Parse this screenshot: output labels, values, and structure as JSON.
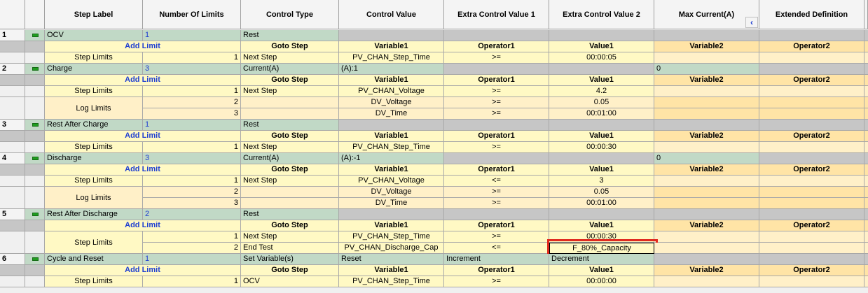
{
  "headers": [
    "",
    "",
    "Step Label",
    "Number Of Limits",
    "Control Type",
    "Control Value",
    "Extra Control Value 1",
    "Extra Control Value 2",
    "Max Current(A)",
    "Extended Definition"
  ],
  "add_limit_label": "Add Limit",
  "scroll_left_glyph": "‹",
  "limit_headers": [
    "Goto Step",
    "Variable1",
    "Operator1",
    "Value1",
    "Variable2",
    "Operator2"
  ],
  "steps": [
    {
      "num": "1",
      "label": "OCV",
      "limits": "1",
      "ctype": "Rest",
      "cvalue": "",
      "extra1": "",
      "extra2": "",
      "maxcur": "",
      "limit_groups": [
        {
          "group": "Step Limits",
          "rows": [
            {
              "n": "1",
              "goto": "Next Step",
              "var1": "PV_CHAN_Step_Time",
              "op1": ">=",
              "val1": "00:00:05"
            }
          ]
        }
      ]
    },
    {
      "num": "2",
      "label": "Charge",
      "limits": "3",
      "ctype": "Current(A)",
      "cvalue": "(A):1",
      "extra1": "",
      "extra2": "",
      "maxcur": "0",
      "limit_groups": [
        {
          "group": "Step Limits",
          "rows": [
            {
              "n": "1",
              "goto": "Next Step",
              "var1": "PV_CHAN_Voltage",
              "op1": ">=",
              "val1": "4.2"
            }
          ]
        },
        {
          "group": "Log Limits",
          "rows": [
            {
              "n": "2",
              "goto": "",
              "var1": "DV_Voltage",
              "op1": ">=",
              "val1": "0.05"
            },
            {
              "n": "3",
              "goto": "",
              "var1": "DV_Time",
              "op1": ">=",
              "val1": "00:01:00"
            }
          ]
        }
      ]
    },
    {
      "num": "3",
      "label": "Rest After Charge",
      "limits": "1",
      "ctype": "Rest",
      "cvalue": "",
      "extra1": "",
      "extra2": "",
      "maxcur": "",
      "limit_groups": [
        {
          "group": "Step Limits",
          "rows": [
            {
              "n": "1",
              "goto": "Next Step",
              "var1": "PV_CHAN_Step_Time",
              "op1": ">=",
              "val1": "00:00:30"
            }
          ]
        }
      ]
    },
    {
      "num": "4",
      "label": "Discharge",
      "limits": "3",
      "ctype": "Current(A)",
      "cvalue": "(A):-1",
      "extra1": "",
      "extra2": "",
      "maxcur": "0",
      "limit_groups": [
        {
          "group": "Step Limits",
          "rows": [
            {
              "n": "1",
              "goto": "Next Step",
              "var1": "PV_CHAN_Voltage",
              "op1": "<=",
              "val1": "3"
            }
          ]
        },
        {
          "group": "Log Limits",
          "rows": [
            {
              "n": "2",
              "goto": "",
              "var1": "DV_Voltage",
              "op1": ">=",
              "val1": "0.05"
            },
            {
              "n": "3",
              "goto": "",
              "var1": "DV_Time",
              "op1": ">=",
              "val1": "00:01:00"
            }
          ]
        }
      ]
    },
    {
      "num": "5",
      "label": "Rest After Discharge",
      "limits": "2",
      "ctype": "Rest",
      "cvalue": "",
      "extra1": "",
      "extra2": "",
      "maxcur": "",
      "limit_groups": [
        {
          "group": "Step Limits",
          "rows": [
            {
              "n": "1",
              "goto": "Next Step",
              "var1": "PV_CHAN_Step_Time",
              "op1": ">=",
              "val1": "00:00:30"
            },
            {
              "n": "2",
              "goto": "End Test",
              "var1": "PV_CHAN_Discharge_Cap",
              "op1": "<=",
              "val1": "F_80%_Capacity",
              "highlight": true
            }
          ]
        }
      ]
    },
    {
      "num": "6",
      "label": "Cycle and Reset",
      "limits": "1",
      "ctype": "Set Variable(s)",
      "cvalue": "Reset",
      "extra1": "Increment",
      "extra2": "Decrement",
      "maxcur": "",
      "limit_groups": [
        {
          "group": "Step Limits",
          "rows": [
            {
              "n": "1",
              "goto": "OCV",
              "var1": "PV_CHAN_Step_Time",
              "op1": ">=",
              "val1": "00:00:00"
            }
          ]
        }
      ]
    }
  ],
  "colors": {
    "step_row": "#c1d9c6",
    "gray": "#c6c6c6",
    "yellow": "#fff9c4",
    "orange": "#ffe4a6",
    "highlight": "#e02a1f",
    "link": "#1f3fd1"
  }
}
